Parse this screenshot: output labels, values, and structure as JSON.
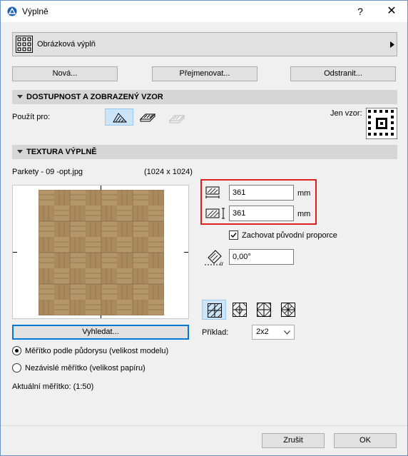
{
  "window": {
    "title": "Výplně",
    "help": "?",
    "close": "✕"
  },
  "fill_selector": {
    "label": "Obrázková výplň"
  },
  "buttons": {
    "new": "Nová...",
    "rename": "Přejmenovat...",
    "delete": "Odstranit...",
    "browse": "Vyhledat...",
    "cancel": "Zrušit",
    "ok": "OK"
  },
  "availability": {
    "header": "DOSTUPNOST A ZOBRAZENÝ VZOR",
    "use_for": "Použít pro:",
    "pattern_only": "Jen vzor:"
  },
  "texture": {
    "header": "TEXTURA VÝPLNĚ",
    "file_name": "Parkety - 09 -opt.jpg",
    "resolution": "(1024 x 1024)",
    "width_value": "361",
    "height_value": "361",
    "unit": "mm",
    "keep_proportions": "Zachovat původní proporce",
    "keep_proportions_checked": true,
    "angle_value": "0,00°",
    "example_label": "Příklad:",
    "example_value": "2x2",
    "scale_model": "Měřítko podle půdorysu (velikost modelu)",
    "scale_paper": "Nezávislé měřítko (velikost papíru)",
    "scale_selected": "model",
    "current_scale": "Aktuální měřítko: (1:50)"
  },
  "colors": {
    "accent": "#0078d7",
    "highlight_box": "#e02020",
    "section_bg": "#d6d6d6",
    "wood": "#a98a5e"
  }
}
